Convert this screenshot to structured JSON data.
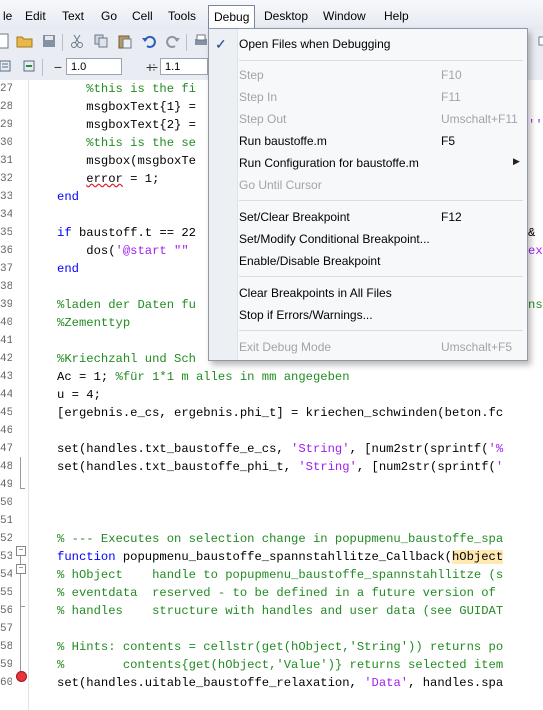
{
  "menubar": {
    "items": [
      "le",
      "Edit",
      "Text",
      "Go",
      "Cell",
      "Tools",
      "Debug",
      "Desktop",
      "Window",
      "Help"
    ]
  },
  "toolbar": {
    "line_spacing_minus": "−",
    "line_spacing_value": "1.0",
    "line_spacing_plus": "+",
    "divide_symbol": "÷",
    "divide_value": "1.1"
  },
  "debug_menu": {
    "open_files_when_debugging": "Open Files when Debugging",
    "step": "Step",
    "step_shortcut": "F10",
    "step_in": "Step In",
    "step_in_shortcut": "F11",
    "step_out": "Step Out",
    "step_out_shortcut": "Umschalt+F11",
    "run": "Run baustoffe.m",
    "run_shortcut": "F5",
    "run_configuration": "Run Configuration for baustoffe.m",
    "go_until_cursor": "Go Until Cursor",
    "set_clear_breakpoint": "Set/Clear Breakpoint",
    "set_clear_breakpoint_shortcut": "F12",
    "set_modify_conditional": "Set/Modify Conditional Breakpoint...",
    "enable_disable": "Enable/Disable Breakpoint",
    "clear_all": "Clear Breakpoints in All Files",
    "stop_if_errors": "Stop if Errors/Warnings...",
    "exit_debug": "Exit Debug Mode",
    "exit_debug_shortcut": "Umschalt+F5"
  },
  "editor": {
    "lines": [
      {
        "num": "27",
        "code": "    %this is the fi"
      },
      {
        "num": "28",
        "code": "    msgboxText{1} ="
      },
      {
        "num": "29",
        "code": "    msgboxText{2} ="
      },
      {
        "num": "30",
        "code": "    %this is the se"
      },
      {
        "num": "31",
        "code": "    msgbox(msgboxTe"
      },
      {
        "num": "32",
        "code": "    error = 1;"
      },
      {
        "num": "33",
        "code": "end"
      },
      {
        "num": "34",
        "code": ""
      },
      {
        "num": "35",
        "code": "if baustoff.t == 22"
      },
      {
        "num": "36",
        "code": "    dos('@start \"\" "
      },
      {
        "num": "37",
        "code": "end"
      },
      {
        "num": "38",
        "code": ""
      },
      {
        "num": "39",
        "code": "%laden der Daten fu"
      },
      {
        "num": "40",
        "code": "%Zementtyp"
      },
      {
        "num": "41",
        "code": ""
      },
      {
        "num": "42",
        "code": "%Kriechzahl und Sch"
      },
      {
        "num": "43",
        "code": "Ac = 1; %für 1*1 m alles in mm angegeben"
      },
      {
        "num": "44",
        "code": "u = 4;"
      },
      {
        "num": "45",
        "code": "[ergebnis.e_cs, ergebnis.phi_t] = kriechen_schwinden(beton.fc"
      },
      {
        "num": "46",
        "code": ""
      },
      {
        "num": "47",
        "code": "set(handles.txt_baustoffe_e_cs, 'String', [num2str(sprintf('%"
      },
      {
        "num": "48",
        "code": "set(handles.txt_baustoffe_phi_t, 'String', [num2str(sprintf('"
      },
      {
        "num": "49",
        "code": ""
      },
      {
        "num": "50",
        "code": ""
      },
      {
        "num": "51",
        "code": ""
      },
      {
        "num": "52",
        "code": "% --- Executes on selection change in popupmenu_baustoffe_spa"
      },
      {
        "num": "53",
        "code": "function popupmenu_baustoffe_spannstahllitze_Callback(hObject"
      },
      {
        "num": "54",
        "code": "% hObject    handle to popupmenu_baustoffe_spannstahllitze (s"
      },
      {
        "num": "55",
        "code": "% eventdata  reserved - to be defined in a future version of"
      },
      {
        "num": "56",
        "code": "% handles    structure with handles and user data (see GUIDAT"
      },
      {
        "num": "57",
        "code": ""
      },
      {
        "num": "58",
        "code": "% Hints: contents = cellstr(get(hObject,'String')) returns po"
      },
      {
        "num": "59",
        "code": "%        contents{get(hObject,'Value')} returns selected item"
      },
      {
        "num": "60",
        "code": "set(handles.uitable_baustoffe_relaxation, 'Data', handles.spa"
      }
    ],
    "right_edge_fragments": {
      "line29": "''",
      "line35": "&",
      "line36": "ex",
      "line39": "ns"
    }
  },
  "colors": {
    "keyword": "#0000ff",
    "comment": "#228b22",
    "string": "#a020f0",
    "breakpoint": "#e8343a",
    "highlight": "#ffe9b0"
  }
}
